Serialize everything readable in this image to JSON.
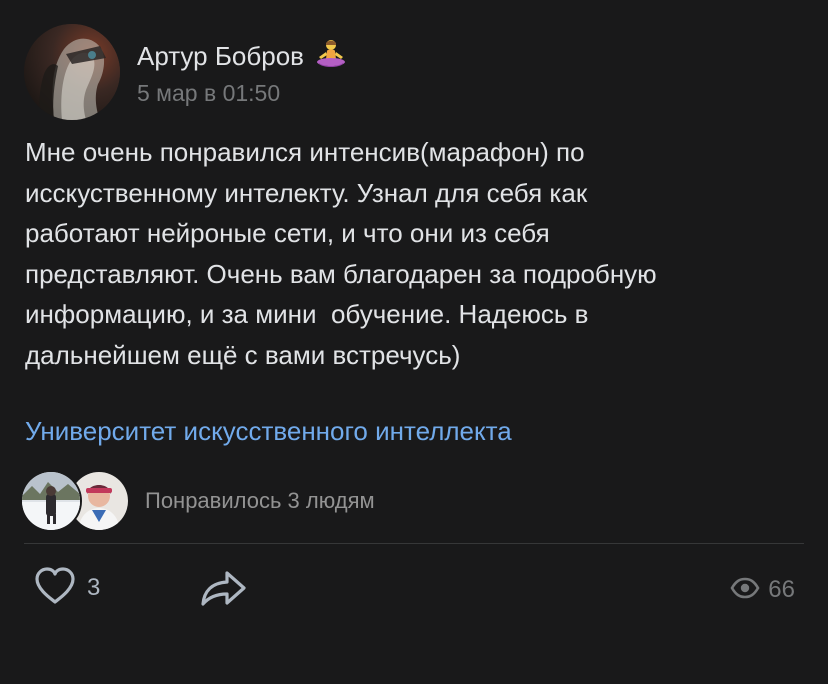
{
  "post": {
    "author": "Артур Бобров",
    "author_emoji": "person-in-lotus-position",
    "time": "5 мар в 01:50",
    "text": "Мне очень понравился интенсив(марафон) по\nисскуственному интелекту. Узнал для себя как\nработают нейроные сети, и что они из себя\nпредставляют. Очень вам благодарен за подробную\nинформацию, и за мини  обучение. Надеюсь в\nдальнейшем ещё с вами встречусь)",
    "group_link": "Университет искусственного интеллекта"
  },
  "likes": {
    "summary": "Понравилось 3 людям",
    "liker_avatars": [
      "liker-avatar-winter-photo",
      "liker-avatar-portrait-photo"
    ]
  },
  "actions": {
    "like_count": "3",
    "like_icon": "heart-icon",
    "share_icon": "share-arrow-icon",
    "views_icon": "eye-icon",
    "views_count": "66"
  },
  "colors": {
    "background": "#19191a",
    "text_primary": "#e1e3e6",
    "text_secondary": "#76787a",
    "link": "#71aaeb",
    "icon": "#aeb7c2"
  }
}
